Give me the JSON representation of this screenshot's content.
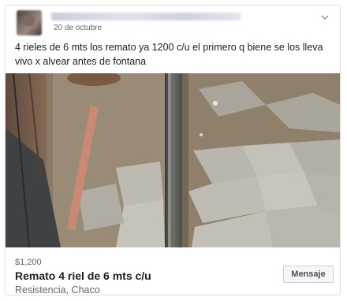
{
  "post": {
    "timestamp": "20 de octubre",
    "text": "4 rieles de 6 mts los remato ya 1200 c/u el primero q biene se los lleva vivo x alvear antes de fontana"
  },
  "listing": {
    "price": "$1,200",
    "title": "Remato 4 riel de 6 mts c/u",
    "location": "Resistencia, Chaco",
    "message_button": "Mensaje"
  },
  "icons": {
    "menu": "chevron-down-icon",
    "avatar": "avatar"
  },
  "colors": {
    "border": "#dddfe2",
    "text_primary": "#1c1e21",
    "text_secondary": "#606770",
    "button_bg": "#f5f6f7"
  }
}
